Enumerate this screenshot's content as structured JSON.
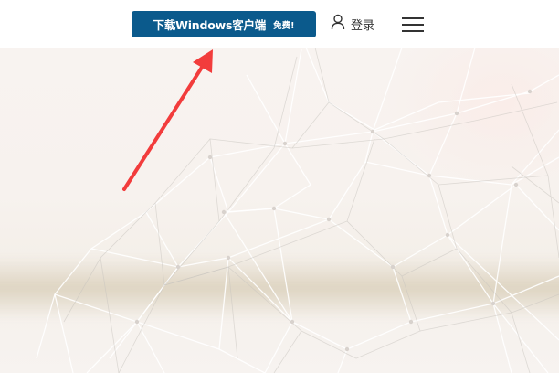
{
  "header": {
    "download_button": {
      "label": "下载Windows客户端",
      "badge": "免费!"
    },
    "login": {
      "label": "登录",
      "icon": "user-icon"
    },
    "menu": {
      "icon": "hamburger-menu-icon"
    }
  },
  "colors": {
    "download_button_bg": "#0b5a8c",
    "annotation_arrow": "#f23c3c",
    "hero_background": "#f7f2ee"
  },
  "hero": {
    "background": "network-lines-pattern"
  },
  "annotation": {
    "type": "arrow",
    "points_to": "download_button"
  }
}
